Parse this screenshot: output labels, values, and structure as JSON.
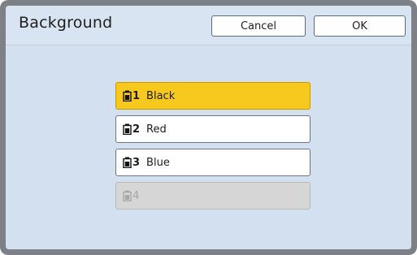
{
  "dialog": {
    "title": "Background",
    "cancel_label": "Cancel",
    "ok_label": "OK"
  },
  "options": [
    {
      "number": "1",
      "label": "Black",
      "icon": "ink-cartridge-icon",
      "state": "selected"
    },
    {
      "number": "2",
      "label": "Red",
      "icon": "ink-cartridge-icon",
      "state": "normal"
    },
    {
      "number": "3",
      "label": "Blue",
      "icon": "ink-cartridge-icon",
      "state": "normal"
    },
    {
      "number": "4",
      "label": "",
      "icon": "ink-cartridge-icon",
      "state": "disabled"
    }
  ],
  "colors": {
    "selected": "#f7c81d",
    "background": "#d3e0f0",
    "disabled": "#d6d6d6"
  }
}
